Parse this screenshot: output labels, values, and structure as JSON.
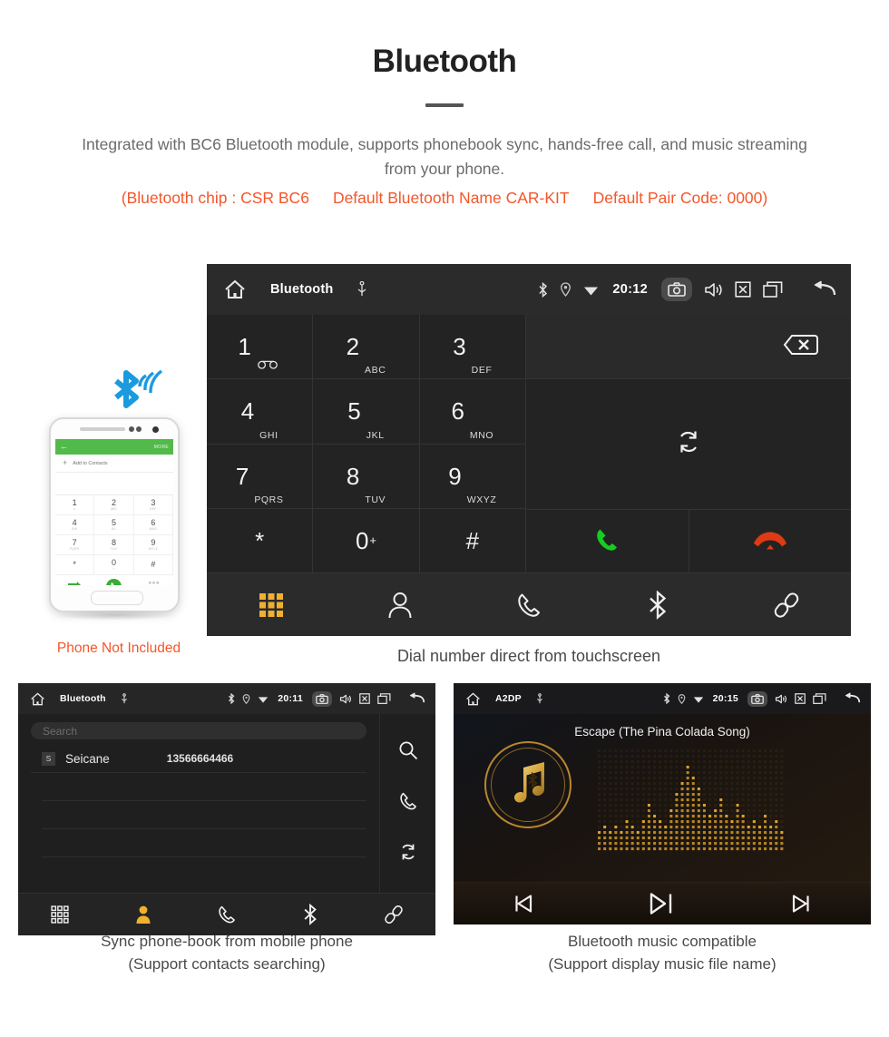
{
  "header": {
    "title": "Bluetooth",
    "subtitle": "Integrated with BC6 Bluetooth module, supports phonebook sync, hands-free call, and music streaming from your phone.",
    "spec_chip": "(Bluetooth chip : CSR BC6",
    "spec_name": "Default Bluetooth Name CAR-KIT",
    "spec_pair": "Default Pair Code: 0000)"
  },
  "colors": {
    "accent_orange": "#f4562a",
    "active_nav": "#f0b030",
    "call_green": "#16cc1e",
    "end_red": "#e03a14",
    "panel_bg": "#1e1e1e",
    "gold": "#c9952f"
  },
  "dialer": {
    "statusbar": {
      "home_icon": "home-icon",
      "title": "Bluetooth",
      "usb_icon": "usb-icon",
      "bt_icon": "bluetooth-icon",
      "location_icon": "location-icon",
      "wifi_icon": "wifi-icon",
      "time": "20:12",
      "camera_icon": "camera-icon",
      "volume_icon": "volume-icon",
      "close_icon": "close-box-icon",
      "recents_icon": "recents-icon",
      "back_icon": "back-icon"
    },
    "keys": [
      {
        "digit": "1",
        "letters": "",
        "icon": "voicemail-icon"
      },
      {
        "digit": "2",
        "letters": "ABC",
        "icon": ""
      },
      {
        "digit": "3",
        "letters": "DEF",
        "icon": ""
      },
      {
        "digit": "4",
        "letters": "GHI",
        "icon": ""
      },
      {
        "digit": "5",
        "letters": "JKL",
        "icon": ""
      },
      {
        "digit": "6",
        "letters": "MNO",
        "icon": ""
      },
      {
        "digit": "7",
        "letters": "PQRS",
        "icon": ""
      },
      {
        "digit": "8",
        "letters": "TUV",
        "icon": ""
      },
      {
        "digit": "9",
        "letters": "WXYZ",
        "icon": ""
      },
      {
        "digit": "*",
        "letters": "",
        "icon": ""
      },
      {
        "digit": "0",
        "letters": "",
        "sup": "+",
        "icon": ""
      },
      {
        "digit": "#",
        "letters": "",
        "icon": ""
      }
    ],
    "backspace_icon": "backspace-icon",
    "sync_icon": "sync-icon",
    "call_icon": "call-icon",
    "end_call_icon": "end-call-icon",
    "nav": [
      {
        "name": "keypad",
        "icon": "keypad-icon",
        "active": true
      },
      {
        "name": "contacts",
        "icon": "contacts-icon",
        "active": false
      },
      {
        "name": "call-log",
        "icon": "phone-icon",
        "active": false
      },
      {
        "name": "bluetooth",
        "icon": "bluetooth-icon",
        "active": false
      },
      {
        "name": "pair",
        "icon": "link-icon",
        "active": false
      }
    ],
    "caption": "Dial number direct from touchscreen"
  },
  "phone_mock": {
    "back_arrow": "←",
    "more_label": "MORE",
    "add_label": "Add to Contacts",
    "plus": "+",
    "keys": [
      {
        "digit": "1",
        "letters": "∞"
      },
      {
        "digit": "2",
        "letters": "ABC"
      },
      {
        "digit": "3",
        "letters": "DEF"
      },
      {
        "digit": "4",
        "letters": "GHI"
      },
      {
        "digit": "5",
        "letters": "JKL"
      },
      {
        "digit": "6",
        "letters": "MNO"
      },
      {
        "digit": "7",
        "letters": "PQRS"
      },
      {
        "digit": "8",
        "letters": "TUV"
      },
      {
        "digit": "9",
        "letters": "WXYZ"
      },
      {
        "digit": "*",
        "letters": ""
      },
      {
        "digit": "0",
        "letters": "+"
      },
      {
        "digit": "#",
        "letters": ""
      }
    ],
    "not_included": "Phone Not Included"
  },
  "contacts_panel": {
    "statusbar": {
      "title": "Bluetooth",
      "time": "20:11"
    },
    "search_placeholder": "Search",
    "contacts": [
      {
        "initial": "S",
        "name": "Seicane",
        "number": "13566664466"
      }
    ],
    "rail": [
      {
        "name": "search",
        "icon": "search-icon"
      },
      {
        "name": "call",
        "icon": "phone-icon"
      },
      {
        "name": "sync",
        "icon": "sync-icon"
      }
    ],
    "nav": [
      {
        "name": "keypad",
        "icon": "keypad-icon",
        "active": false
      },
      {
        "name": "contacts",
        "icon": "contacts-icon",
        "active": true
      },
      {
        "name": "call-log",
        "icon": "phone-icon",
        "active": false
      },
      {
        "name": "bluetooth",
        "icon": "bluetooth-icon",
        "active": false
      },
      {
        "name": "pair",
        "icon": "link-icon",
        "active": false
      }
    ],
    "caption_line1": "Sync phone-book from mobile phone",
    "caption_line2": "(Support contacts searching)"
  },
  "music_panel": {
    "statusbar": {
      "title": "A2DP",
      "time": "20:15"
    },
    "track_title": "Escape (The Pina Colada Song)",
    "album_icon": "music-note-bluetooth-icon",
    "controls": [
      {
        "name": "previous",
        "icon": "previous-track-icon"
      },
      {
        "name": "play-pause",
        "icon": "play-pause-icon"
      },
      {
        "name": "next",
        "icon": "next-track-icon"
      }
    ],
    "caption_line1": "Bluetooth music compatible",
    "caption_line2": "(Support display music file name)"
  }
}
